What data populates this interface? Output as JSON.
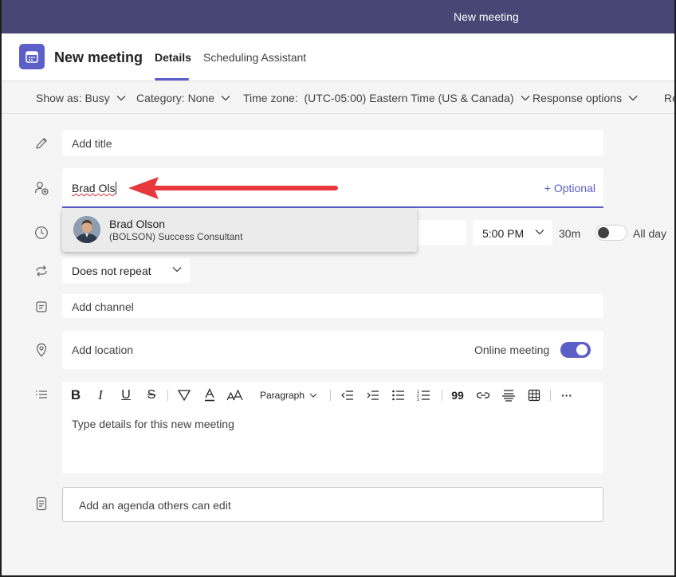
{
  "window": {
    "title": "New meeting"
  },
  "header": {
    "title": "New meeting",
    "tabs": [
      {
        "label": "Details",
        "active": true
      },
      {
        "label": "Scheduling Assistant",
        "active": false
      }
    ]
  },
  "options": {
    "show_as": "Show as: Busy",
    "category": "Category: None",
    "time_zone": "Time zone:  (UTC-05:00) Eastern Time (US & Canada)",
    "response_options": "Response options",
    "truncated": "Re"
  },
  "form": {
    "title_placeholder": "Add title",
    "attendee_value": "Brad Ols",
    "optional_link": "+ Optional",
    "end_time": "5:00 PM",
    "duration": "30m",
    "all_day_label": "All day",
    "all_day_on": false,
    "repeat": "Does not repeat",
    "channel_placeholder": "Add channel",
    "location_placeholder": "Add location",
    "online_meeting_label": "Online meeting",
    "online_meeting_on": true,
    "details_placeholder": "Type details for this new meeting",
    "agenda_placeholder": "Add an agenda others can edit"
  },
  "editor_toolbar": {
    "bold": "B",
    "italic": "I",
    "underline": "U",
    "strike": "S",
    "paragraph_label": "Paragraph",
    "quote": "99",
    "more": "···"
  },
  "suggestion": {
    "name": "Brad Olson",
    "subtitle": "(BOLSON) Success Consultant"
  },
  "colors": {
    "titlebar": "#464775",
    "accent": "#5b5fc7",
    "arrow": "#e8383d"
  }
}
